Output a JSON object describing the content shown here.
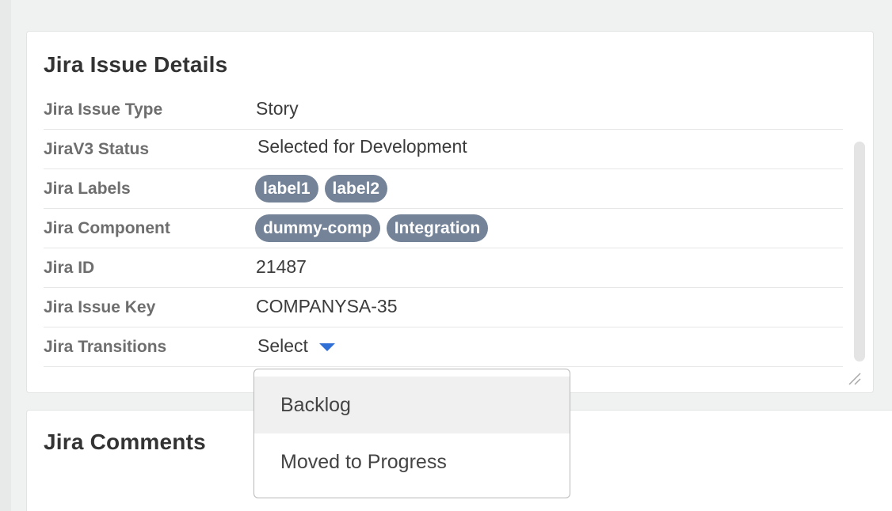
{
  "details": {
    "title": "Jira Issue Details",
    "rows": [
      {
        "label": "Jira Issue Type",
        "value": "Story"
      },
      {
        "label": "JiraV3 Status",
        "value": "Selected for Development"
      },
      {
        "label": "Jira Labels",
        "pills": [
          "label1",
          "label2"
        ]
      },
      {
        "label": "Jira Component",
        "pills": [
          "dummy-comp",
          "Integration"
        ]
      },
      {
        "label": "Jira ID",
        "value": "21487"
      },
      {
        "label": "Jira Issue Key",
        "value": "COMPANYSA-35"
      },
      {
        "label": "Jira Transitions",
        "select_value": "Select"
      }
    ]
  },
  "dropdown": {
    "options": [
      "Backlog",
      "Moved to Progress"
    ],
    "highlighted": "Backlog"
  },
  "comments": {
    "title": "Jira Comments"
  },
  "colors": {
    "pill_bg": "#748397",
    "caret": "#2f6fd6"
  },
  "icons": {
    "transition_caret": "chevron-down-icon",
    "resize": "resize-handle-icon"
  }
}
